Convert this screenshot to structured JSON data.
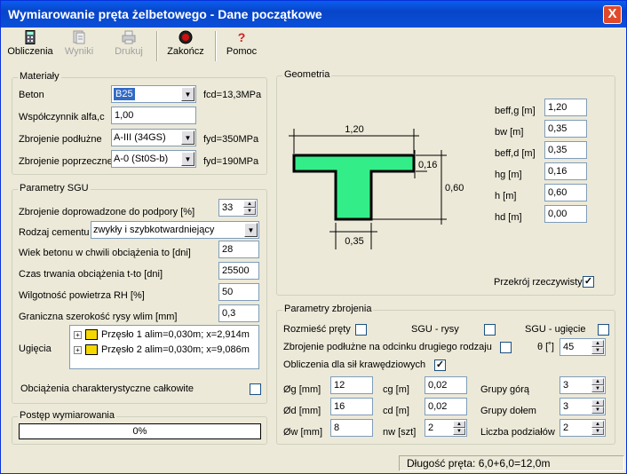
{
  "window": {
    "title": "Wymiarowanie pręta żelbetowego - Dane początkowe",
    "close_glyph": "X"
  },
  "toolbar": {
    "obliczenia": "Obliczenia",
    "wyniki": "Wyniki",
    "drukuj": "Drukuj",
    "zakoncz": "Zakończ",
    "pomoc": "Pomoc",
    "help_glyph": "?"
  },
  "materialy": {
    "caption": "Materiały",
    "beton_label": "Beton",
    "beton_value": "B25",
    "fcd": "fcd=13,3MPa",
    "alfa_label": "Współczynnik alfa,c",
    "alfa_value": "1,00",
    "podluzne_label": "Zbrojenie podłużne",
    "podluzne_value": "A-III (34GS)",
    "fyd1": "fyd=350MPa",
    "poprzeczne_label": "Zbrojenie poprzeczne",
    "poprzeczne_value": "A-0 (St0S-b)",
    "fyd2": "fyd=190MPa"
  },
  "sgu": {
    "caption": "Parametry SGU",
    "zbr_label": "Zbrojenie doprowadzone do podpory [%]",
    "zbr_value": "33",
    "cement_label": "Rodzaj cementu",
    "cement_value": "zwykły i szybkotwardniejący",
    "wiek_label": "Wiek betonu w chwili obciążenia to [dni]",
    "wiek_value": "28",
    "czas_label": "Czas trwania obciążenia t-to [dni]",
    "czas_value": "25500",
    "wilg_label": "Wilgotność powietrza RH [%]",
    "wilg_value": "50",
    "rysa_label": "Graniczna szerokość rysy wlim [mm]",
    "rysa_value": "0,3",
    "ugiecia_label": "Ugięcia",
    "ugiecia_items": [
      "Przęsło 1 alim=0,030m; x=2,914m",
      "Przęsło 2 alim=0,030m; x=9,086m"
    ],
    "char_label": "Obciążenia charakterystyczne całkowite"
  },
  "postep": {
    "caption": "Postęp wymiarowania",
    "value": "0%"
  },
  "geometria": {
    "caption": "Geometria",
    "dim_top": "1,20",
    "dim_flange": "0,16",
    "dim_h": "0,60",
    "dim_web": "0,35",
    "fields": [
      {
        "label": "beff,g [m]",
        "value": "1,20"
      },
      {
        "label": "bw [m]",
        "value": "0,35"
      },
      {
        "label": "beff,d [m]",
        "value": "0,35"
      },
      {
        "label": "hg [m]",
        "value": "0,16"
      },
      {
        "label": "h [m]",
        "value": "0,60"
      },
      {
        "label": "hd [m]",
        "value": "0,00"
      }
    ],
    "przekroj_label": "Przekrój rzeczywisty",
    "shape_color": "#33ee88"
  },
  "zbrojenie": {
    "caption": "Parametry zbrojenia",
    "rozmiesc": "Rozmieść pręty",
    "sgu_rysy": "SGU - rysy",
    "sgu_ugiecie": "SGU - ugięcie",
    "odcinek": "Zbrojenie podłużne na odcinku drugiego rodzaju",
    "theta_label": "θ [˚]",
    "theta_value": "45",
    "sily": "Obliczenia dla sił krawędziowych",
    "og_label": "Øg [mm]",
    "og_value": "12",
    "od_label": "Ød [mm]",
    "od_value": "16",
    "ow_label": "Øw [mm]",
    "ow_value": "8",
    "cg_label": "cg [m]",
    "cg_value": "0,02",
    "cd_label": "cd [m]",
    "cd_value": "0,02",
    "nw_label": "nw [szt]",
    "nw_value": "2",
    "gora_label": "Grupy górą",
    "gora_value": "3",
    "dolem_label": "Grupy dołem",
    "dolem_value": "3",
    "podzialow_label": "Liczba podziałów",
    "podzialow_value": "2"
  },
  "status": {
    "text": "Długość pręta: 6,0+6,0=12,0m"
  },
  "check_glyph": "✓"
}
